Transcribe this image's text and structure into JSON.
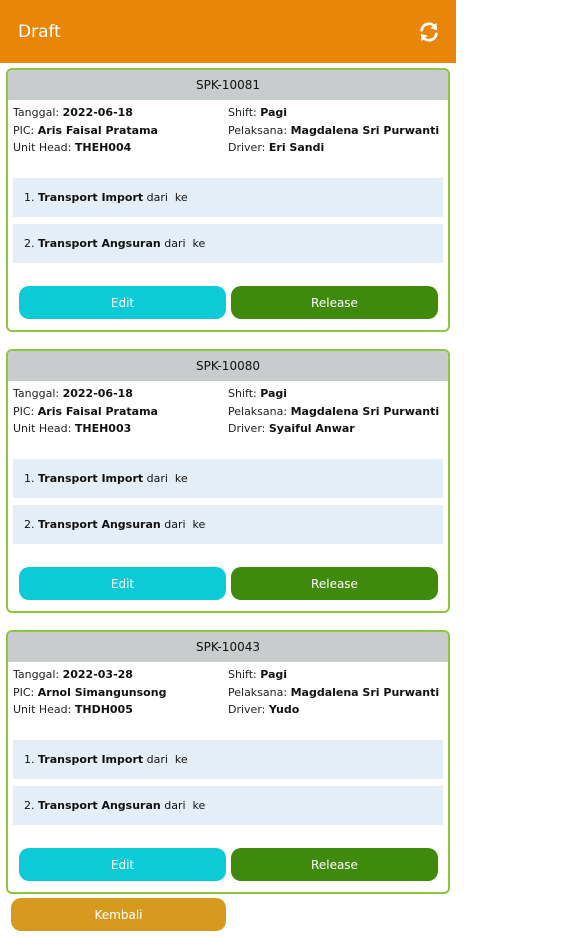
{
  "header": {
    "title": "Draft",
    "refresh_icon": "refresh-icon"
  },
  "labels": {
    "tanggal": "Tanggal:",
    "pic": "PIC:",
    "unit_head": "Unit Head:",
    "shift": "Shift:",
    "pelaksana": "Pelaksana:",
    "driver": "Driver:",
    "edit": "Edit",
    "release": "Release",
    "from_to": " dari  ke"
  },
  "cards": [
    {
      "code": "SPK-10081",
      "tanggal": "2022-06-18",
      "pic": "Aris Faisal Pratama",
      "unit_head": "THEH004",
      "shift": "Pagi",
      "pelaksana": "Magdalena Sri Purwanti",
      "driver": "Eri Sandi",
      "tasks": [
        {
          "num": "1. ",
          "name": "Transport Import"
        },
        {
          "num": "2. ",
          "name": "Transport Angsuran"
        }
      ]
    },
    {
      "code": "SPK-10080",
      "tanggal": "2022-06-18",
      "pic": "Aris Faisal Pratama",
      "unit_head": "THEH003",
      "shift": "Pagi",
      "pelaksana": "Magdalena Sri Purwanti",
      "driver": "Syaiful Anwar",
      "tasks": [
        {
          "num": "1. ",
          "name": "Transport Import"
        },
        {
          "num": "2. ",
          "name": "Transport Angsuran"
        }
      ]
    },
    {
      "code": "SPK-10043",
      "tanggal": "2022-03-28",
      "pic": "Arnol Simangunsong",
      "unit_head": "THDH005",
      "shift": "Pagi",
      "pelaksana": "Magdalena Sri Purwanti",
      "driver": "Yudo",
      "tasks": [
        {
          "num": "1. ",
          "name": "Transport Import"
        },
        {
          "num": "2. ",
          "name": "Transport Angsuran"
        }
      ]
    }
  ],
  "footer": {
    "back_label": "Kembali"
  },
  "colors": {
    "header_bg": "#e9860a",
    "card_border": "#8dc63f",
    "edit_bg": "#0ccbd6",
    "release_bg": "#3f8a0c",
    "back_bg": "#d69a1f"
  }
}
